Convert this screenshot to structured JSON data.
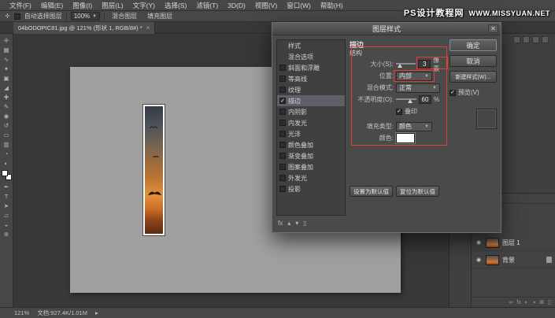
{
  "watermark": {
    "site": "PS设计教程网",
    "url": "WWW.MISSYUAN.NET"
  },
  "menubar": {
    "items": [
      "文件(F)",
      "编辑(E)",
      "图像(I)",
      "图层(L)",
      "文字(Y)",
      "选择(S)",
      "滤镜(T)",
      "3D(D)",
      "视图(V)",
      "窗口(W)",
      "帮助(H)"
    ]
  },
  "optionsbar": {
    "auto_select": "自动选择图层",
    "zoom": "100%",
    "button1": "混合图层",
    "button2": "填充图层"
  },
  "tabbar": {
    "doc_title": "04bODOPIC81.jpg @ 121% (形状 1, RGB/8#) *",
    "close": "×"
  },
  "tools": [
    {
      "name": "move",
      "glyph": "✛"
    },
    {
      "name": "rect-marquee",
      "glyph": "▦"
    },
    {
      "name": "lasso",
      "glyph": "∿"
    },
    {
      "name": "quick-selection",
      "glyph": "✦"
    },
    {
      "name": "crop",
      "glyph": "▣"
    },
    {
      "name": "eyedropper",
      "glyph": "◢"
    },
    {
      "name": "spot-healing",
      "glyph": "✚"
    },
    {
      "name": "brush",
      "glyph": "✎"
    },
    {
      "name": "clone-stamp",
      "glyph": "◉"
    },
    {
      "name": "history-brush",
      "glyph": "↺"
    },
    {
      "name": "eraser",
      "glyph": "▭"
    },
    {
      "name": "gradient",
      "glyph": "▥"
    },
    {
      "name": "blur",
      "glyph": "◔"
    },
    {
      "name": "dodge",
      "glyph": "◐"
    },
    {
      "name": "pen",
      "glyph": "✒"
    },
    {
      "name": "type",
      "glyph": "T"
    },
    {
      "name": "path-selection",
      "glyph": "➤"
    },
    {
      "name": "shape",
      "glyph": "▱"
    },
    {
      "name": "hand",
      "glyph": "◒"
    },
    {
      "name": "zoom",
      "glyph": "⊕"
    }
  ],
  "dialog": {
    "title": "图层样式",
    "close": "✕",
    "styles_list": [
      {
        "label": "样式",
        "check": ""
      },
      {
        "label": "混合选项",
        "check": ""
      },
      {
        "label": "斜面和浮雕",
        "check": ""
      },
      {
        "label": "等高线",
        "check": ""
      },
      {
        "label": "纹理",
        "check": ""
      },
      {
        "label": "描边",
        "check": "✓"
      },
      {
        "label": "内阴影",
        "check": ""
      },
      {
        "label": "内发光",
        "check": ""
      },
      {
        "label": "光泽",
        "check": ""
      },
      {
        "label": "颜色叠加",
        "check": ""
      },
      {
        "label": "渐变叠加",
        "check": ""
      },
      {
        "label": "图案叠加",
        "check": ""
      },
      {
        "label": "外发光",
        "check": ""
      },
      {
        "label": "投影",
        "check": ""
      }
    ],
    "fx_label": "fx",
    "section_title": "描边",
    "structure_label": "结构",
    "size_label": "大小(S):",
    "size_value": "3",
    "size_unit": "像素",
    "position_label": "位置:",
    "position_value": "内部",
    "blend_label": "混合模式:",
    "blend_value": "正常",
    "opacity_label": "不透明度(O):",
    "opacity_value": "60",
    "opacity_unit": "%",
    "overprint_label": "叠印",
    "overprint_check": "✓",
    "fill_type_label": "填充类型:",
    "fill_type_value": "颜色",
    "color_label": "颜色:",
    "stroke_color": "#ffffff",
    "set_default": "设置为默认值",
    "reset_default": "复位为默认值",
    "ok": "确定",
    "cancel": "取消",
    "new_style": "新建样式(W)...",
    "preview_label": "预览(V)",
    "preview_check": "✓",
    "annotation_color": "#ea3b30"
  },
  "layers": {
    "rows": [
      {
        "name": "图层 1"
      },
      {
        "name": "背景"
      }
    ],
    "bottom_icons": [
      {
        "name": "link-layers",
        "glyph": "∞"
      },
      {
        "name": "layer-style",
        "glyph": "fx"
      },
      {
        "name": "layer-mask",
        "glyph": "◐"
      },
      {
        "name": "adjustment-layer",
        "glyph": "◑"
      },
      {
        "name": "new-layer",
        "glyph": "⊞"
      },
      {
        "name": "delete-layer",
        "glyph": "▯"
      }
    ]
  },
  "statusbar": {
    "zoom": "121%",
    "doc_info": "文档:927.4K/1.01M",
    "arrow": "▸"
  }
}
